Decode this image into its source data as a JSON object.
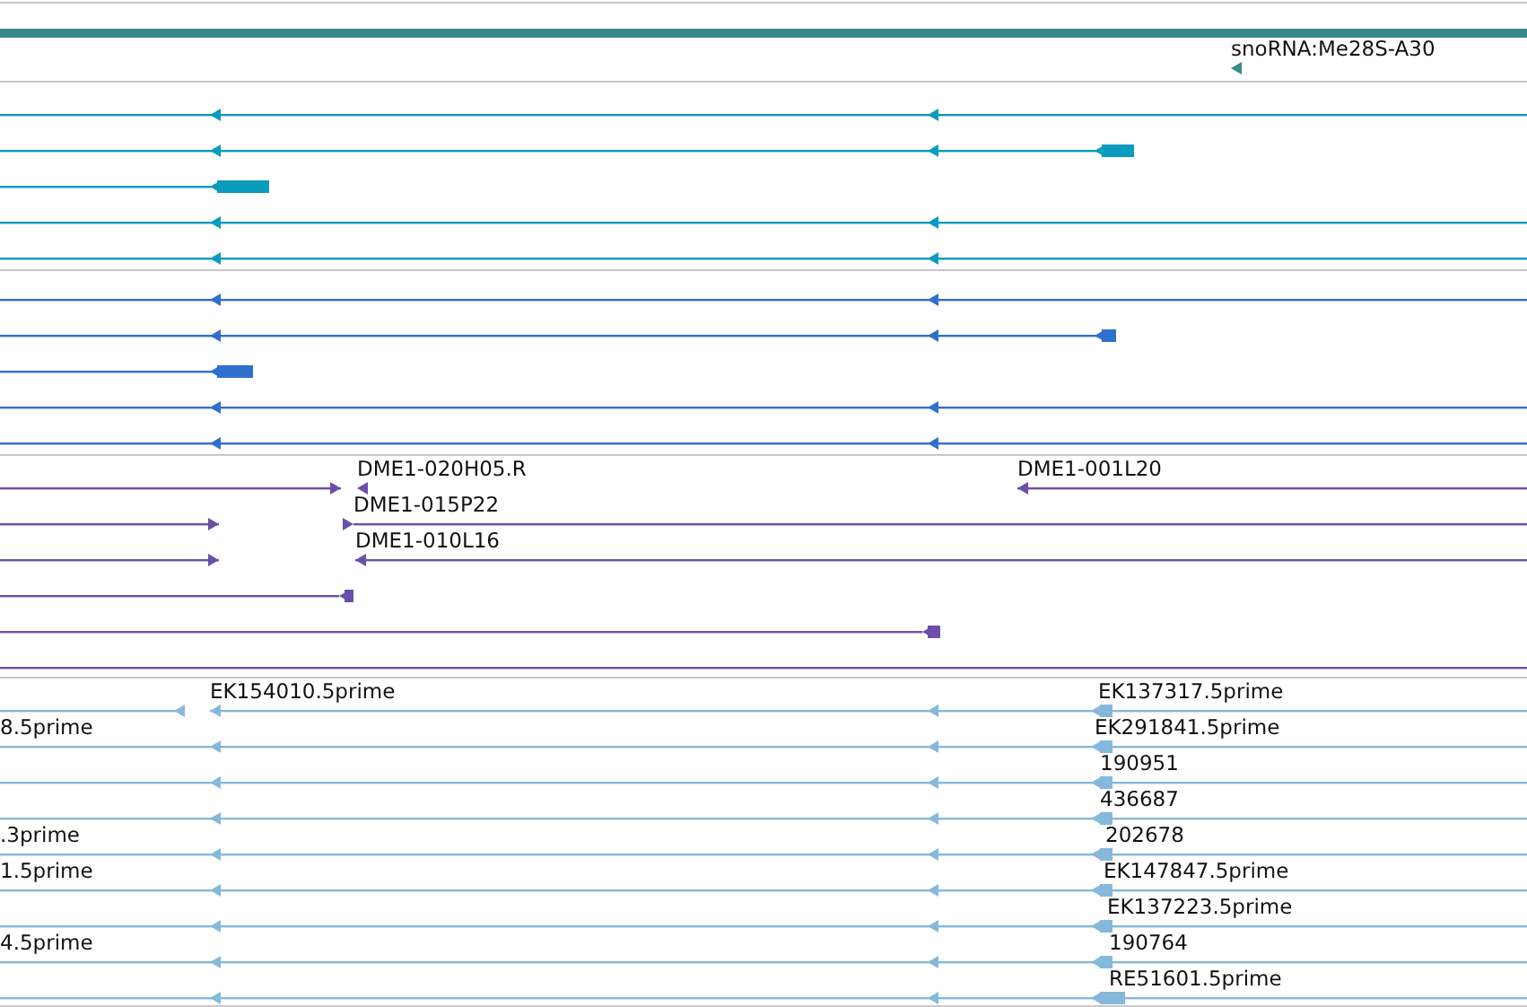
{
  "tracks": [
    {
      "color": "#368a8e",
      "rows": [
        {
          "features": [
            {
              "label": "snoRNA:Me28S-A30",
              "reverse": true
            }
          ]
        }
      ]
    },
    {
      "color": "#0a9bbd",
      "rows": [
        {
          "features": [
            {
              "reverse": true
            }
          ]
        },
        {
          "features": [
            {
              "reverse": true
            }
          ]
        },
        {
          "features": [
            {
              "reverse": true
            }
          ]
        },
        {
          "features": [
            {
              "reverse": true
            }
          ]
        },
        {
          "features": [
            {
              "reverse": true
            }
          ]
        }
      ]
    },
    {
      "color": "#2f6fce",
      "rows": [
        {
          "features": [
            {
              "reverse": true
            }
          ]
        },
        {
          "features": [
            {
              "reverse": true
            }
          ]
        },
        {
          "features": [
            {
              "reverse": true
            }
          ]
        },
        {
          "features": [
            {
              "reverse": true
            }
          ]
        },
        {
          "features": [
            {
              "reverse": true
            }
          ]
        }
      ]
    },
    {
      "color": "#6a4fa8",
      "rows": [
        {
          "features": [
            {
              "reverse": false
            },
            {
              "label": "DME1-020H05.R",
              "reverse": true
            },
            {
              "label": "DME1-001L20",
              "reverse": true
            }
          ]
        },
        {
          "features": [
            {
              "reverse": false
            },
            {
              "label": "DME1-015P22",
              "reverse": false
            }
          ]
        },
        {
          "features": [
            {
              "reverse": false
            },
            {
              "label": "DME1-010L16",
              "reverse": true
            }
          ]
        },
        {
          "features": [
            {
              "reverse": true
            }
          ]
        },
        {
          "features": [
            {
              "reverse": true
            }
          ]
        }
      ],
      "spanning_feature": true
    },
    {
      "color": "#86b8dc",
      "rows": [
        {
          "features": [
            {
              "reverse": true
            },
            {
              "label": "EK154010.5prime",
              "reverse": true
            },
            {
              "label": "EK137317.5prime",
              "reverse": true
            }
          ]
        },
        {
          "features": [
            {
              "label": "8.5prime",
              "reverse": true
            },
            {
              "label": "EK291841.5prime",
              "reverse": true
            }
          ]
        },
        {
          "features": [
            {
              "reverse": true
            },
            {
              "label": "190951",
              "reverse": true
            }
          ]
        },
        {
          "features": [
            {
              "reverse": true
            },
            {
              "label": "436687",
              "reverse": true
            }
          ]
        },
        {
          "features": [
            {
              "label": ".3prime",
              "reverse": true
            },
            {
              "label": "202678",
              "reverse": true
            }
          ]
        },
        {
          "features": [
            {
              "label": "1.5prime",
              "reverse": true
            },
            {
              "label": "EK147847.5prime",
              "reverse": true
            }
          ]
        },
        {
          "features": [
            {
              "reverse": true
            },
            {
              "label": "EK137223.5prime",
              "reverse": true
            }
          ]
        },
        {
          "features": [
            {
              "label": "4.5prime",
              "reverse": true
            },
            {
              "label": "190764",
              "reverse": true
            }
          ]
        },
        {
          "features": [
            {
              "reverse": true
            },
            {
              "label": "RE51601.5prime",
              "reverse": true
            }
          ]
        }
      ]
    }
  ]
}
